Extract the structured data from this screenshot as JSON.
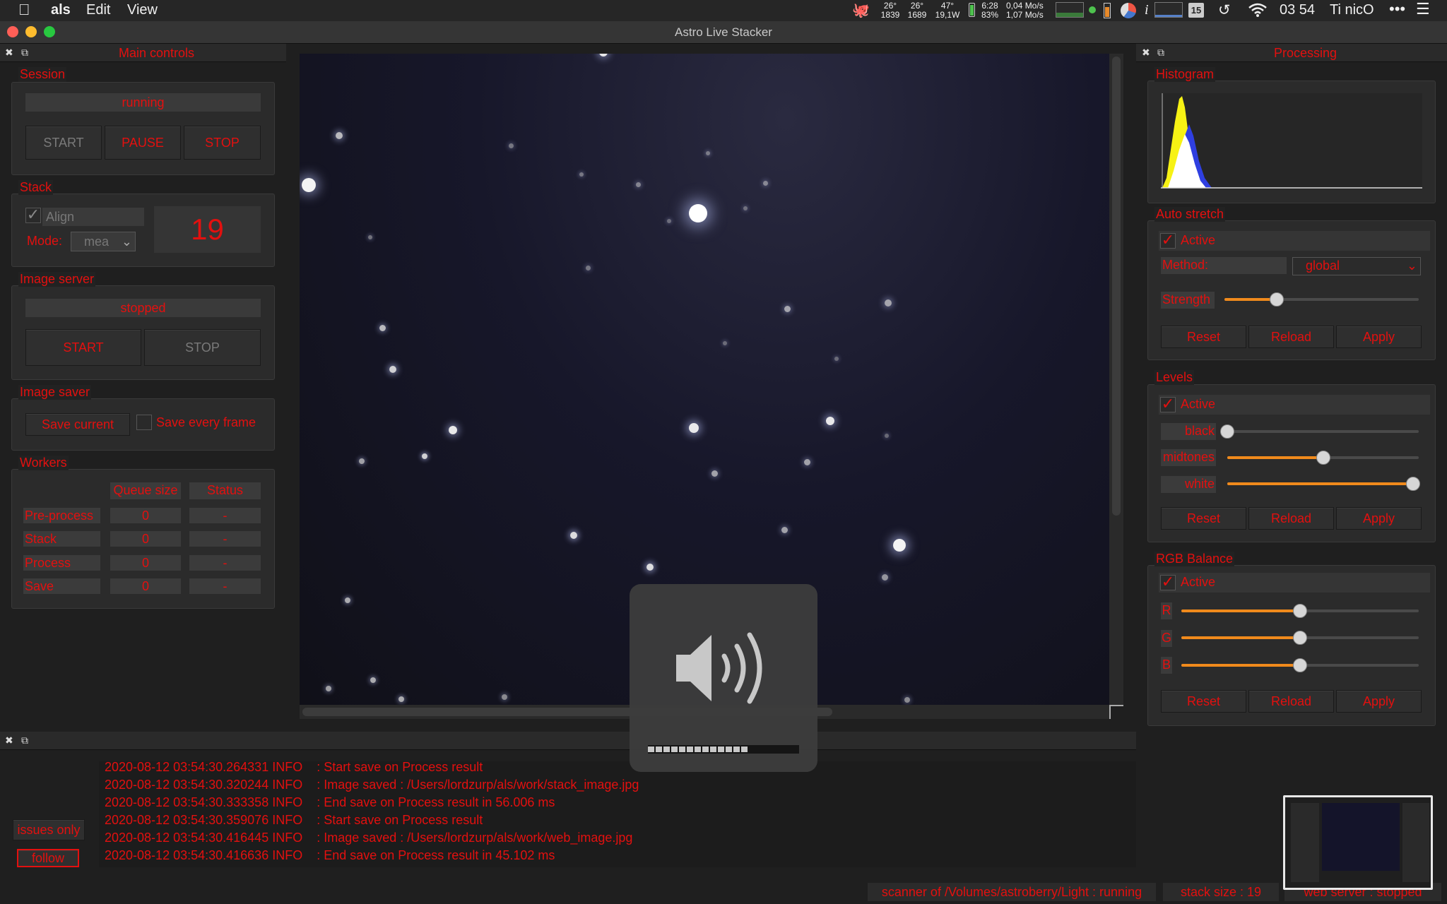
{
  "menubar": {
    "app_name": "als",
    "menus": [
      "Edit",
      "View"
    ],
    "status": {
      "temp1": "26°",
      "temp1b": "1839",
      "temp2": "26°",
      "temp2b": "1689",
      "temp3": "47°",
      "temp3b": "19,1W",
      "battery_time": "6:28",
      "battery_pct": "83%",
      "net_up": "0,04 Mo/s",
      "net_down": "1,07 Mo/s",
      "cal_day": "15",
      "clock": "03 54",
      "user": "Ti nicO"
    }
  },
  "window": {
    "title": "Astro Live Stacker"
  },
  "left_panel": {
    "title": "Main controls",
    "session": {
      "title": "Session",
      "status": "running",
      "start": "START",
      "pause": "PAUSE",
      "stop": "STOP"
    },
    "stack": {
      "title": "Stack",
      "align_label": "Align",
      "mode_label": "Mode:",
      "mode_value": "mea",
      "count": "19"
    },
    "image_server": {
      "title": "Image server",
      "status": "stopped",
      "start": "START",
      "stop": "STOP"
    },
    "image_saver": {
      "title": "Image saver",
      "save_current": "Save current",
      "save_every": "Save every frame"
    },
    "workers": {
      "title": "Workers",
      "col_queue": "Queue size",
      "col_status": "Status",
      "rows": [
        {
          "name": "Pre-process",
          "queue": "0",
          "status": "-"
        },
        {
          "name": "Stack",
          "queue": "0",
          "status": "-"
        },
        {
          "name": "Process",
          "queue": "0",
          "status": "-"
        },
        {
          "name": "Save",
          "queue": "0",
          "status": "-"
        }
      ]
    }
  },
  "right_panel": {
    "title": "Processing",
    "histogram": {
      "title": "Histogram"
    },
    "autostretch": {
      "title": "Auto stretch",
      "active": "Active",
      "method_label": "Method:",
      "method_value": "global",
      "strength_label": "Strength",
      "strength_level": 0.27,
      "reset": "Reset",
      "reload": "Reload",
      "apply": "Apply"
    },
    "levels": {
      "title": "Levels",
      "active": "Active",
      "black": "black",
      "midtones": "midtones",
      "white": "white",
      "black_level": 0.0,
      "mid_level": 0.5,
      "white_level": 0.97,
      "reset": "Reset",
      "reload": "Reload",
      "apply": "Apply"
    },
    "rgb": {
      "title": "RGB Balance",
      "active": "Active",
      "r": "R",
      "g": "G",
      "b": "B",
      "r_level": 0.5,
      "g_level": 0.5,
      "b_level": 0.5,
      "reset": "Reset",
      "reload": "Reload",
      "apply": "Apply"
    }
  },
  "log": {
    "issues_only": "issues only",
    "follow": "follow",
    "lines": [
      "2020-08-12 03:54:30.264331 INFO    : Start save on Process result",
      "2020-08-12 03:54:30.320244 INFO    : Image saved : /Users/lordzurp/als/work/stack_image.jpg",
      "2020-08-12 03:54:30.333358 INFO    : End save on Process result in 56.006 ms",
      "2020-08-12 03:54:30.359076 INFO    : Start save on Process result",
      "2020-08-12 03:54:30.416445 INFO    : Image saved : /Users/lordzurp/als/work/web_image.jpg",
      "2020-08-12 03:54:30.416636 INFO    : End save on Process result in 45.102 ms"
    ]
  },
  "statusbar": {
    "scanner": "scanner of /Volumes/astroberry/Light : running",
    "stack_size": "stack size : 19",
    "web_server": "web server : stopped"
  },
  "volume_hud": {
    "level": 0.66
  },
  "colors": {
    "accent": "#e3100f",
    "slider": "#f08a1c",
    "bg": "#1f1f1f"
  }
}
